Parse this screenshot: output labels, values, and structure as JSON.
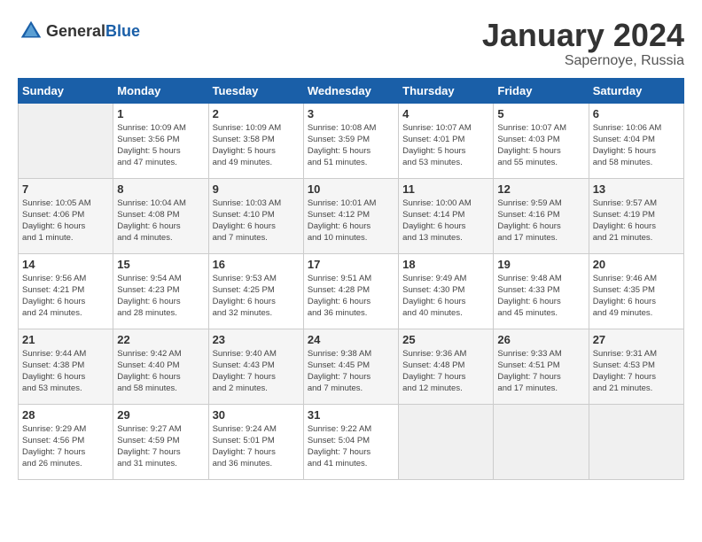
{
  "header": {
    "logo": {
      "text_general": "General",
      "text_blue": "Blue"
    },
    "title": "January 2024",
    "subtitle": "Sapernoye, Russia"
  },
  "days_of_week": [
    "Sunday",
    "Monday",
    "Tuesday",
    "Wednesday",
    "Thursday",
    "Friday",
    "Saturday"
  ],
  "weeks": [
    [
      {
        "day": null,
        "info": null
      },
      {
        "day": "1",
        "info": "Sunrise: 10:09 AM\nSunset: 3:56 PM\nDaylight: 5 hours\nand 47 minutes."
      },
      {
        "day": "2",
        "info": "Sunrise: 10:09 AM\nSunset: 3:58 PM\nDaylight: 5 hours\nand 49 minutes."
      },
      {
        "day": "3",
        "info": "Sunrise: 10:08 AM\nSunset: 3:59 PM\nDaylight: 5 hours\nand 51 minutes."
      },
      {
        "day": "4",
        "info": "Sunrise: 10:07 AM\nSunset: 4:01 PM\nDaylight: 5 hours\nand 53 minutes."
      },
      {
        "day": "5",
        "info": "Sunrise: 10:07 AM\nSunset: 4:03 PM\nDaylight: 5 hours\nand 55 minutes."
      },
      {
        "day": "6",
        "info": "Sunrise: 10:06 AM\nSunset: 4:04 PM\nDaylight: 5 hours\nand 58 minutes."
      }
    ],
    [
      {
        "day": "7",
        "info": "Sunrise: 10:05 AM\nSunset: 4:06 PM\nDaylight: 6 hours\nand 1 minute."
      },
      {
        "day": "8",
        "info": "Sunrise: 10:04 AM\nSunset: 4:08 PM\nDaylight: 6 hours\nand 4 minutes."
      },
      {
        "day": "9",
        "info": "Sunrise: 10:03 AM\nSunset: 4:10 PM\nDaylight: 6 hours\nand 7 minutes."
      },
      {
        "day": "10",
        "info": "Sunrise: 10:01 AM\nSunset: 4:12 PM\nDaylight: 6 hours\nand 10 minutes."
      },
      {
        "day": "11",
        "info": "Sunrise: 10:00 AM\nSunset: 4:14 PM\nDaylight: 6 hours\nand 13 minutes."
      },
      {
        "day": "12",
        "info": "Sunrise: 9:59 AM\nSunset: 4:16 PM\nDaylight: 6 hours\nand 17 minutes."
      },
      {
        "day": "13",
        "info": "Sunrise: 9:57 AM\nSunset: 4:19 PM\nDaylight: 6 hours\nand 21 minutes."
      }
    ],
    [
      {
        "day": "14",
        "info": "Sunrise: 9:56 AM\nSunset: 4:21 PM\nDaylight: 6 hours\nand 24 minutes."
      },
      {
        "day": "15",
        "info": "Sunrise: 9:54 AM\nSunset: 4:23 PM\nDaylight: 6 hours\nand 28 minutes."
      },
      {
        "day": "16",
        "info": "Sunrise: 9:53 AM\nSunset: 4:25 PM\nDaylight: 6 hours\nand 32 minutes."
      },
      {
        "day": "17",
        "info": "Sunrise: 9:51 AM\nSunset: 4:28 PM\nDaylight: 6 hours\nand 36 minutes."
      },
      {
        "day": "18",
        "info": "Sunrise: 9:49 AM\nSunset: 4:30 PM\nDaylight: 6 hours\nand 40 minutes."
      },
      {
        "day": "19",
        "info": "Sunrise: 9:48 AM\nSunset: 4:33 PM\nDaylight: 6 hours\nand 45 minutes."
      },
      {
        "day": "20",
        "info": "Sunrise: 9:46 AM\nSunset: 4:35 PM\nDaylight: 6 hours\nand 49 minutes."
      }
    ],
    [
      {
        "day": "21",
        "info": "Sunrise: 9:44 AM\nSunset: 4:38 PM\nDaylight: 6 hours\nand 53 minutes."
      },
      {
        "day": "22",
        "info": "Sunrise: 9:42 AM\nSunset: 4:40 PM\nDaylight: 6 hours\nand 58 minutes."
      },
      {
        "day": "23",
        "info": "Sunrise: 9:40 AM\nSunset: 4:43 PM\nDaylight: 7 hours\nand 2 minutes."
      },
      {
        "day": "24",
        "info": "Sunrise: 9:38 AM\nSunset: 4:45 PM\nDaylight: 7 hours\nand 7 minutes."
      },
      {
        "day": "25",
        "info": "Sunrise: 9:36 AM\nSunset: 4:48 PM\nDaylight: 7 hours\nand 12 minutes."
      },
      {
        "day": "26",
        "info": "Sunrise: 9:33 AM\nSunset: 4:51 PM\nDaylight: 7 hours\nand 17 minutes."
      },
      {
        "day": "27",
        "info": "Sunrise: 9:31 AM\nSunset: 4:53 PM\nDaylight: 7 hours\nand 21 minutes."
      }
    ],
    [
      {
        "day": "28",
        "info": "Sunrise: 9:29 AM\nSunset: 4:56 PM\nDaylight: 7 hours\nand 26 minutes."
      },
      {
        "day": "29",
        "info": "Sunrise: 9:27 AM\nSunset: 4:59 PM\nDaylight: 7 hours\nand 31 minutes."
      },
      {
        "day": "30",
        "info": "Sunrise: 9:24 AM\nSunset: 5:01 PM\nDaylight: 7 hours\nand 36 minutes."
      },
      {
        "day": "31",
        "info": "Sunrise: 9:22 AM\nSunset: 5:04 PM\nDaylight: 7 hours\nand 41 minutes."
      },
      {
        "day": null,
        "info": null
      },
      {
        "day": null,
        "info": null
      },
      {
        "day": null,
        "info": null
      }
    ]
  ]
}
